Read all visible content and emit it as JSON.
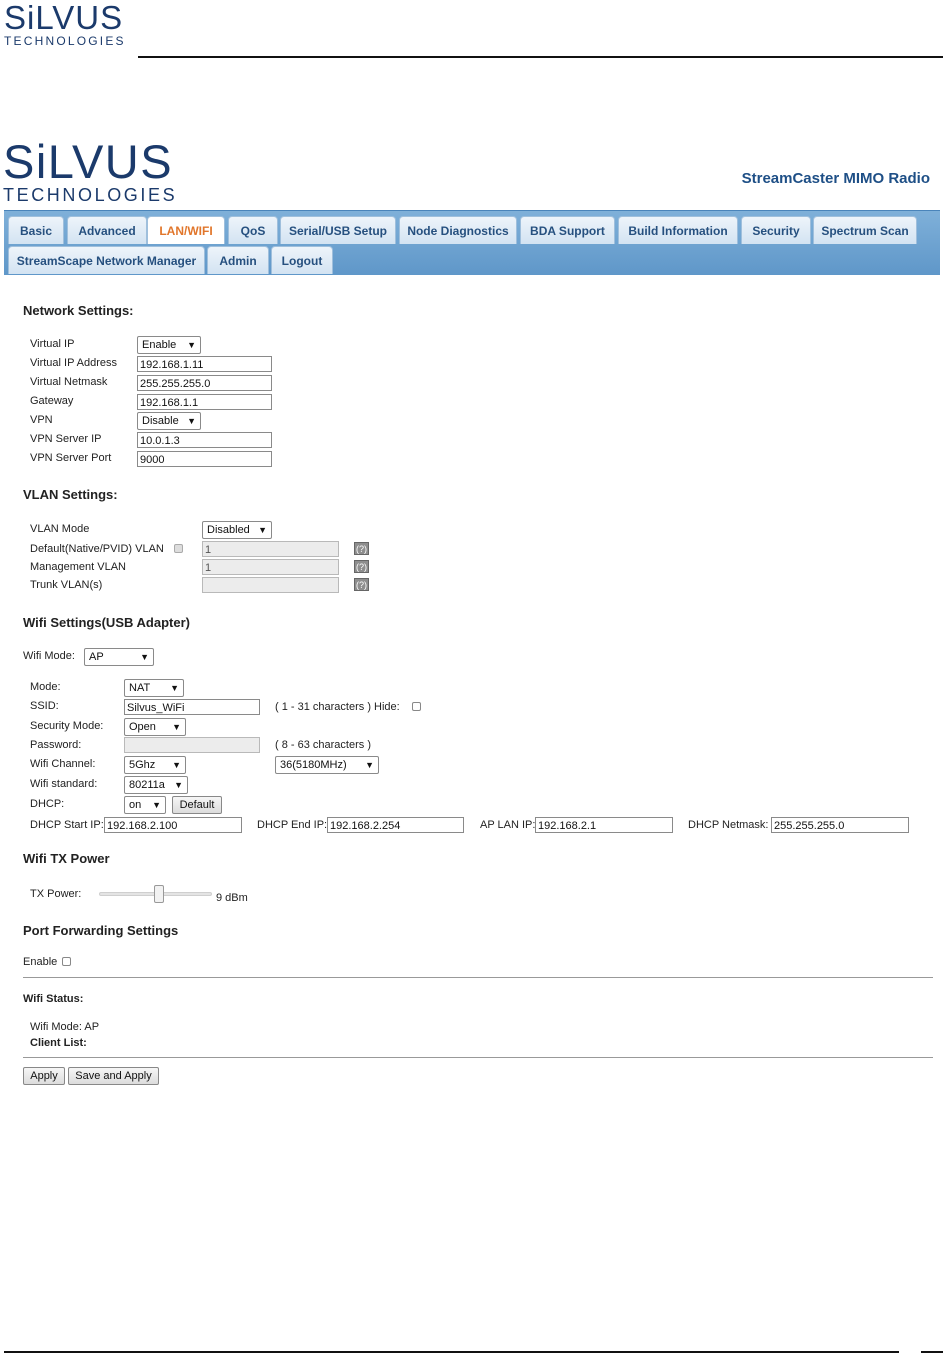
{
  "doc_header": {
    "logo_brand": "SiLVUS",
    "logo_sub": "TECHNOLOGIES"
  },
  "app_header": {
    "logo_brand": "SiLVUS",
    "logo_sub": "TECHNOLOGIES",
    "title": "StreamCaster MIMO Radio"
  },
  "nav": {
    "tabs": [
      "Basic",
      "Advanced",
      "LAN/WIFI",
      "QoS",
      "Serial/USB Setup",
      "Node Diagnostics",
      "BDA Support",
      "Build Information",
      "Security",
      "Spectrum Scan",
      "StreamScape Network Manager",
      "Admin",
      "Logout"
    ],
    "active": "LAN/WIFI"
  },
  "network": {
    "heading": "Network Settings:",
    "virtual_ip_label": "Virtual IP",
    "virtual_ip_value": "Enable",
    "virtual_ip_address_label": "Virtual IP Address",
    "virtual_ip_address_value": "192.168.1.11",
    "virtual_netmask_label": "Virtual Netmask",
    "virtual_netmask_value": "255.255.255.0",
    "gateway_label": "Gateway",
    "gateway_value": "192.168.1.1",
    "vpn_label": "VPN",
    "vpn_value": "Disable",
    "vpn_server_ip_label": "VPN Server IP",
    "vpn_server_ip_value": "10.0.1.3",
    "vpn_server_port_label": "VPN Server Port",
    "vpn_server_port_value": "9000"
  },
  "vlan": {
    "heading": "VLAN Settings:",
    "mode_label": "VLAN Mode",
    "mode_value": "Disabled",
    "default_label": "Default(Native/PVID) VLAN",
    "default_value": "1",
    "management_label": "Management VLAN",
    "management_value": "1",
    "trunk_label": "Trunk VLAN(s)",
    "trunk_value": "",
    "help": "(?)"
  },
  "wifi": {
    "heading": "Wifi Settings(USB Adapter)",
    "wifi_mode_label": "Wifi Mode:",
    "wifi_mode_value": "AP",
    "mode_label": "Mode:",
    "mode_value": "NAT",
    "ssid_label": "SSID:",
    "ssid_value": "Silvus_WiFi",
    "ssid_hint": "( 1 - 31 characters ) Hide:",
    "security_label": "Security Mode:",
    "security_value": "Open",
    "password_label": "Password:",
    "password_value": "",
    "password_hint": "( 8 - 63 characters )",
    "channel_label": "Wifi Channel:",
    "band_value": "5Ghz",
    "channel_value": "36(5180MHz)",
    "standard_label": "Wifi standard:",
    "standard_value": "80211a",
    "dhcp_label": "DHCP:",
    "dhcp_value": "on",
    "default_button": "Default",
    "dhcp_start_label": "DHCP Start IP:",
    "dhcp_start_value": "192.168.2.100",
    "dhcp_end_label": "DHCP End IP:",
    "dhcp_end_value": "192.168.2.254",
    "ap_lan_label": "AP LAN IP:",
    "ap_lan_value": "192.168.2.1",
    "dhcp_netmask_label": "DHCP Netmask:",
    "dhcp_netmask_value": "255.255.255.0"
  },
  "tx_power": {
    "heading": "Wifi TX Power",
    "label": "TX Power:",
    "value_text": "9 dBm",
    "level": 0.53
  },
  "port_forwarding": {
    "heading": "Port Forwarding Settings",
    "enable_label": "Enable"
  },
  "status": {
    "heading": "Wifi Status:",
    "mode_line": "Wifi Mode: AP",
    "client_list_label": "Client List:"
  },
  "actions": {
    "apply": "Apply",
    "save_apply": "Save and Apply"
  }
}
